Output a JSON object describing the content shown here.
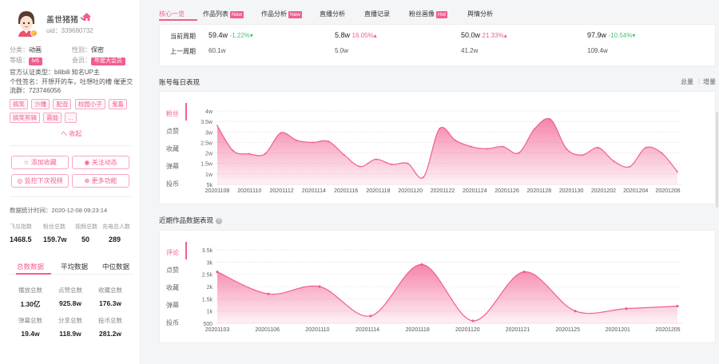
{
  "profile": {
    "name": "盖世猪猪丶",
    "uid": "uid：339680732",
    "category_label": "分类：",
    "category": "动画",
    "gender_label": "性别：",
    "gender": "保密",
    "level_label": "等级：",
    "level": "lv6",
    "member_label": "会员：",
    "member": "年度大会员",
    "cert": "官方认证类型：bilibili 知名UP主",
    "sign": "个性签名：开想开的车，吐想吐的槽 催更交流群：723746056",
    "tags": [
      "搞笑",
      "沙雕",
      "配音",
      "校园小子",
      "鬼畜",
      "搞笑剪辑",
      "震能",
      "..."
    ],
    "collapse": "へ 收起"
  },
  "buttons": {
    "collect": "☆ 添加收藏",
    "follow": "◉ 关注动态",
    "monitor": "◎ 监控下次视频",
    "more": "⊕ 更多功能"
  },
  "stat_time": "数据统计时间：2020-12-08 09:23:14",
  "stats": [
    {
      "label": "飞瓜指数",
      "value": "1468.5"
    },
    {
      "label": "粉丝总数",
      "value": "159.7w"
    },
    {
      "label": "视频总数",
      "value": "50"
    },
    {
      "label": "充电总人数",
      "value": "289"
    }
  ],
  "data_tabs": [
    "总数数据",
    "平均数据",
    "中位数据"
  ],
  "totals": [
    {
      "label": "播放总数",
      "value": "1.30亿"
    },
    {
      "label": "点赞总数",
      "value": "925.8w"
    },
    {
      "label": "收藏总数",
      "value": "176.3w"
    },
    {
      "label": "弹幕总数",
      "value": "19.4w"
    },
    {
      "label": "分享总数",
      "value": "118.9w"
    },
    {
      "label": "投币总数",
      "value": "281.2w"
    }
  ],
  "nav": {
    "tabs": [
      "核心一览",
      "作品列表",
      "作品分析",
      "直播分析",
      "直播记录",
      "粉丝画像",
      "舆情分析"
    ],
    "badges": {
      "new": "New",
      "hot": "Hot"
    }
  },
  "compare": {
    "current_label": "当前周期",
    "prev_label": "上一周期",
    "items": [
      {
        "value": "59.4w",
        "change": "-1.22%",
        "dir": "down",
        "prev": "60.1w"
      },
      {
        "value": "5.8w",
        "change": "16.05%",
        "dir": "up",
        "prev": "5.0w"
      },
      {
        "value": "50.0w",
        "change": "21.33%",
        "dir": "up",
        "prev": "41.2w"
      },
      {
        "value": "97.9w",
        "change": "-10.54%",
        "dir": "down",
        "prev": "109.4w"
      }
    ]
  },
  "daily": {
    "title": "账号每日表现",
    "toggle_total": "总量",
    "toggle_sep": "|",
    "toggle_inc": "增量",
    "metric_tabs": [
      "粉丝",
      "点赞",
      "收藏",
      "弹幕",
      "投币"
    ]
  },
  "recent": {
    "title": "近期作品数据表现",
    "metric_tabs": [
      "评论",
      "点赞",
      "收藏",
      "弹幕",
      "投币"
    ]
  },
  "chart_data": [
    {
      "type": "area",
      "title": "账号每日表现",
      "y_ticks": [
        "5k",
        "1w",
        "1.5w",
        "2w",
        "2.5w",
        "3w",
        "3.5w",
        "4w"
      ],
      "ylim": [
        5000,
        40000
      ],
      "x_ticks": [
        "20201108",
        "20201110",
        "20201112",
        "20201114",
        "20201116",
        "20201118",
        "20201120",
        "20201122",
        "20201124",
        "20201126",
        "20201128",
        "20201130",
        "20201202",
        "20201204",
        "20201206"
      ],
      "series": [
        {
          "values": [
            33000,
            21000,
            19500,
            19500,
            29500,
            26000,
            25000,
            25500,
            19000,
            13500,
            17000,
            14500,
            15000,
            8500,
            31500,
            26000,
            23000,
            22000,
            23000,
            20000,
            31500,
            36000,
            22000,
            19000,
            22500,
            16000,
            13500,
            22500,
            20000,
            11000
          ]
        }
      ],
      "color": "#f25d8e"
    },
    {
      "type": "area",
      "title": "近期作品数据表现",
      "y_ticks": [
        "500",
        "1k",
        "1.5k",
        "2k",
        "2.5k",
        "3k",
        "3.5k"
      ],
      "ylim": [
        500,
        3500
      ],
      "x_ticks": [
        "20201103",
        "20201106",
        "20201110",
        "20201114",
        "20201118",
        "20201120",
        "20201121",
        "20201125",
        "20201201",
        "20201205"
      ],
      "series": [
        {
          "values": [
            2600,
            1700,
            2000,
            800,
            2900,
            600,
            2600,
            1000,
            1100,
            1200
          ]
        }
      ],
      "color": "#f25d8e"
    }
  ]
}
